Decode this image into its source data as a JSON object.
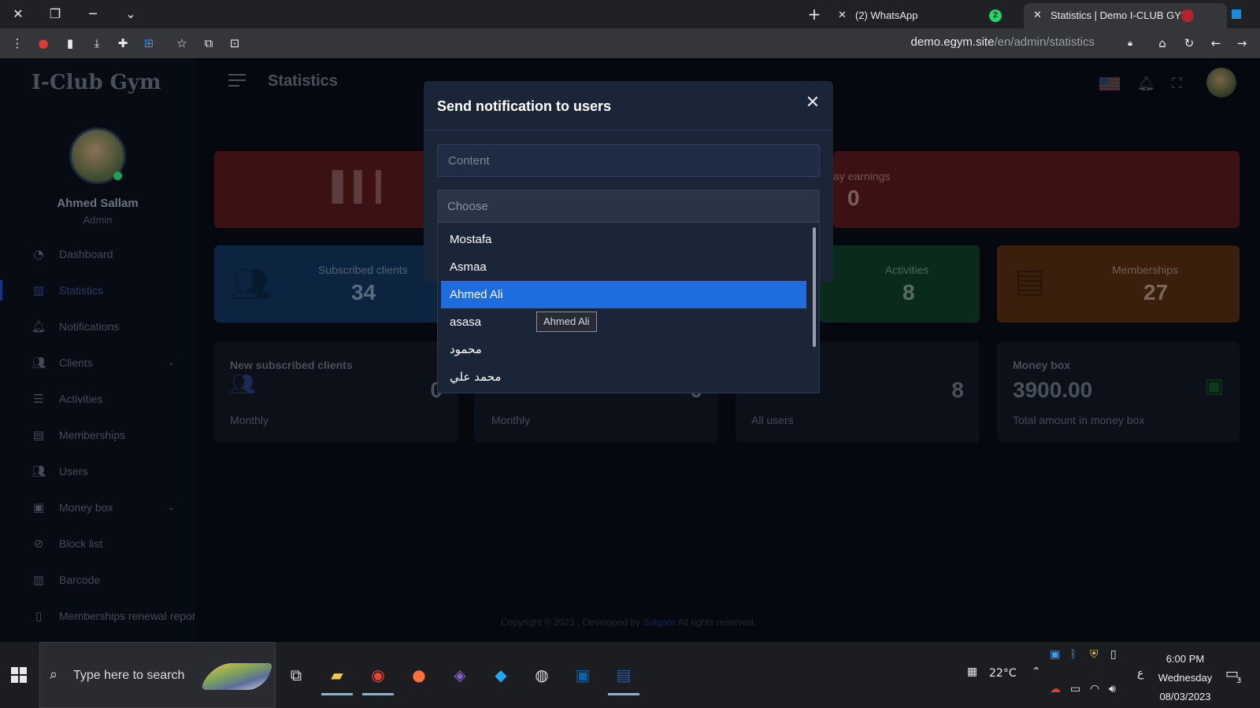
{
  "browser": {
    "tabs": [
      {
        "title": "(2) WhatsApp",
        "badge": "2"
      },
      {
        "title": "Statistics | Demo I-CLUB GYM"
      }
    ],
    "url_host": "demo.egym.site",
    "url_path": "/en/admin/statistics"
  },
  "app": {
    "logo": "I-Club Gym",
    "page_title": "Statistics",
    "user": {
      "name": "Ahmed Sallam",
      "role": "Admin"
    },
    "nav": [
      {
        "label": "Dashboard",
        "icon": "dashboard-icon"
      },
      {
        "label": "Statistics",
        "icon": "chart-icon"
      },
      {
        "label": "Notifications",
        "icon": "bell-icon"
      },
      {
        "label": "Clients",
        "icon": "users-icon"
      },
      {
        "label": "Activities",
        "icon": "list-icon"
      },
      {
        "label": "Memberships",
        "icon": "id-card-icon"
      },
      {
        "label": "Users",
        "icon": "users-icon"
      },
      {
        "label": "Money box",
        "icon": "money-icon"
      },
      {
        "label": "Block list",
        "icon": "ban-icon"
      },
      {
        "label": "Barcode",
        "icon": "barcode-icon"
      },
      {
        "label": "Memberships renewal repor",
        "icon": "file-icon"
      }
    ],
    "cards_top": {
      "earnings_label": "ay earnings",
      "earnings_value": "0"
    },
    "cards_mid": [
      {
        "label": "Subscribed clients",
        "value": "34"
      },
      {
        "label": "Activities",
        "value": "8"
      },
      {
        "label": "Memberships",
        "value": "27"
      }
    ],
    "cards_bottom": [
      {
        "label": "New subscribed clients",
        "value": "0",
        "sub": "Monthly"
      },
      {
        "label": "",
        "value": "0",
        "sub": "Monthly"
      },
      {
        "label": "",
        "value": "8",
        "sub": "All users"
      },
      {
        "label": "Money box",
        "value": "3900.00",
        "sub": "Total amount in money box"
      }
    ],
    "footer": {
      "prefix": "Copyright © 2023 . Developed by",
      "link": "Satgate",
      "suffix": "All rights reserved."
    }
  },
  "modal": {
    "title": "Send notification to users",
    "content_placeholder": "Content",
    "choose_placeholder": "Choose",
    "options": [
      "Mostafa",
      "Asmaa",
      "Ahmed Ali",
      "asasa",
      "محمود",
      "محمد علي"
    ],
    "selected": "Ahmed Ali",
    "tooltip": "Ahmed Ali"
  },
  "taskbar": {
    "search_placeholder": "Type here to search",
    "temperature": "22°C",
    "time": "6:00 PM",
    "day": "Wednesday",
    "date": "08/03/2023",
    "notif_count": "3",
    "lang": "ع"
  },
  "colors": {
    "accent": "#1d6ce0",
    "modal_bg": "#1a2538"
  }
}
